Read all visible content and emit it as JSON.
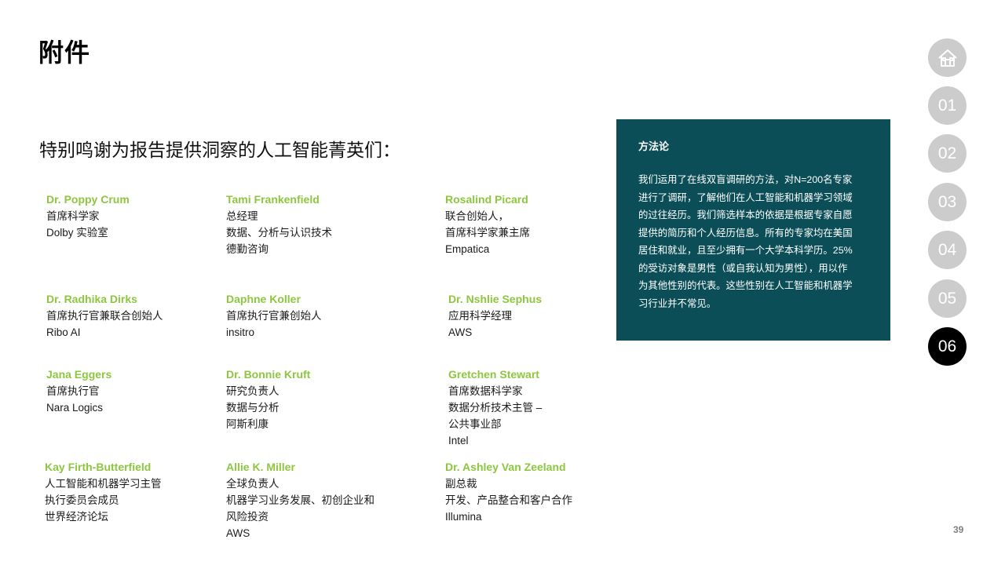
{
  "page": {
    "title": "附件",
    "subtitle": "特别鸣谢为报告提供洞察的人工智能菁英们：",
    "page_number": "39"
  },
  "contributors": [
    {
      "name": "Dr. Poppy Crum",
      "lines": [
        "首席科学家",
        "Dolby 实验室"
      ]
    },
    {
      "name": "Tami Frankenfield",
      "lines": [
        "总经理",
        "数据、分析与认识技术",
        "德勤咨询"
      ]
    },
    {
      "name": "Rosalind Picard",
      "lines": [
        "联合创始人，",
        "首席科学家兼主席",
        "Empatica"
      ]
    },
    {
      "name": "Dr. Radhika Dirks",
      "lines": [
        "首席执行官兼联合创始人",
        "Ribo AI"
      ]
    },
    {
      "name": "Daphne Koller",
      "lines": [
        "首席执行官兼创始人",
        "insitro"
      ]
    },
    {
      "name": "Dr. Nshlie Sephus",
      "lines": [
        "应用科学经理",
        "AWS"
      ]
    },
    {
      "name": "Jana Eggers",
      "lines": [
        "首席执行官",
        "Nara Logics"
      ]
    },
    {
      "name": "Dr. Bonnie Kruft",
      "lines": [
        "研究负责人",
        "数据与分析",
        "阿斯利康"
      ]
    },
    {
      "name": "Gretchen Stewart",
      "lines": [
        "首席数据科学家",
        "数据分析技术主管 –",
        "公共事业部",
        "Intel"
      ]
    },
    {
      "name": "Kay Firth-Butterfield",
      "lines": [
        "人工智能和机器学习主管",
        "执行委员会成员",
        "世界经济论坛"
      ]
    },
    {
      "name": "Allie K. Miller",
      "lines": [
        "全球负责人",
        "机器学习业务发展、初创企业和",
        "风险投资",
        "AWS"
      ]
    },
    {
      "name": "Dr. Ashley Van Zeeland",
      "lines": [
        "副总裁",
        "开发、产品整合和客户合作",
        "Illumina"
      ]
    }
  ],
  "methodology": {
    "title": "方法论",
    "lines": [
      "我们运用了在线双盲调研的方法，对N=200名专家",
      "进行了调研，了解他们在人工智能和机器学习领域",
      "的过往经历。我们筛选样本的依据是根据专家自愿",
      "提供的简历和个人经历信息。所有的专家均在美国",
      "居住和就业，且至少拥有一个大学本科学历。25%",
      "的受访对象是男性（或自我认知为男性），用以作",
      "为其他性别的代表。这些性别在人工智能和机器学",
      "习行业并不常见。"
    ]
  },
  "nav": {
    "home_icon": "home-icon",
    "items": [
      "01",
      "02",
      "03",
      "04",
      "05",
      "06"
    ],
    "active": "06"
  },
  "colors": {
    "name_green": "#8dc63f",
    "method_bg": "#0c4e57",
    "nav_inactive": "#cccccc",
    "nav_active": "#000000"
  }
}
